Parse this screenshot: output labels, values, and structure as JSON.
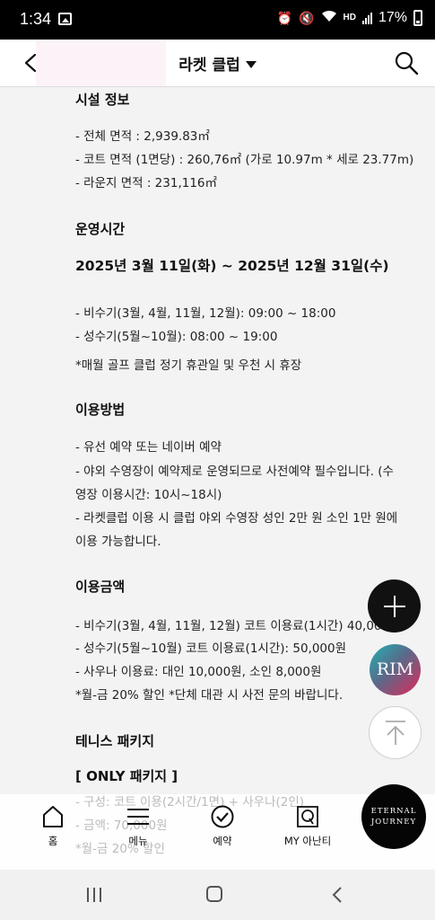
{
  "status_bar": {
    "time": "1:34",
    "battery": "17%",
    "network": "HD"
  },
  "appbar": {
    "title": "라켓 클럽",
    "back_icon": "back-chevron-icon",
    "search_icon": "search-icon"
  },
  "sections": {
    "facility": {
      "title": "시설 정보",
      "lines": [
        "- 전체 면적 : 2,939.83㎡",
        "- 코트 면적 (1면당) : 260,76㎡ (가로 10.97m * 세로 23.77m)",
        "- 라운지 면적 : 231,116㎡"
      ]
    },
    "hours": {
      "title": "운영시간",
      "date_range": "2025년 3월 11일(화) ~ 2025년 12월 31일(수)",
      "lines": [
        "- 비수기(3월, 4월, 11월, 12월): 09:00 ~ 18:00",
        "- 성수기(5월~10월): 08:00 ~ 19:00",
        "*매월 골프 클럽 정기 휴관일 및 우천 시 휴장"
      ]
    },
    "usage": {
      "title": "이용방법",
      "lines": [
        "- 유선 예약 또는 네이버 예약",
        "- 야외 수영장이 예약제로 운영되므로 사전예약 필수입니다. (수",
        "영장 이용시간: 10시~18시)",
        "- 라켓클럽 이용 시 클럽 야외 수영장 성인 2만 원 소인 1만 원에",
        "이용 가능합니다."
      ]
    },
    "price": {
      "title": "이용금액",
      "lines": [
        "- 비수기(3월, 4월, 11월, 12월) 코트 이용료(1시간) 40,000원",
        "- 성수기(5월~10월) 코트 이용료(1시간): 50,000원",
        "- 사우나 이용료: 대인 10,000원, 소인 8,000원",
        "*월-금 20% 할인 *단체 대관 시 사전 문의 바랍니다."
      ]
    },
    "package": {
      "title": "테니스 패키지",
      "subtitle": "[ ONLY 패키지 ]",
      "lines": [
        "- 구성: 코트 이용(2시간/1면) + 사우나(2인)",
        "- 금액: 70,000원",
        "*월-금 20% 할인"
      ]
    }
  },
  "fabs": {
    "add_icon": "plus-icon",
    "rim_label": "RIM",
    "top_icon": "arrow-up-icon"
  },
  "bottom_nav": {
    "items": [
      {
        "label": "홈",
        "icon": "home-icon"
      },
      {
        "label": "메뉴",
        "icon": "menu-icon"
      },
      {
        "label": "예약",
        "icon": "check-circle-icon"
      },
      {
        "label": "MY 아난티",
        "icon": "my-ananti-icon"
      }
    ],
    "badge_line1": "ETERNAL",
    "badge_line2": "JOURNEY"
  }
}
